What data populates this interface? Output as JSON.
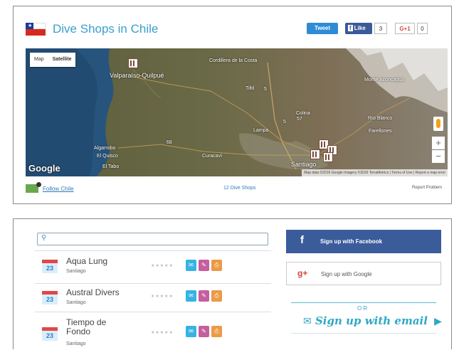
{
  "header": {
    "title": "Dive Shops in Chile",
    "tweet_label": "Tweet",
    "like_label": "Like",
    "like_count": "3",
    "gplus_label": "G+1",
    "gplus_count": "0"
  },
  "map": {
    "types": [
      "Map",
      "Satellite"
    ],
    "selected_type": "Satellite",
    "labels": {
      "valparaiso": "Valparaíso-Quilpué",
      "santiago": "Santiago",
      "algarrobo": "Algarrobo",
      "el_tabo": "El Tabo",
      "pinos": "Pinos",
      "el_quisco": "El Quisco",
      "curacavi": "Curacaví",
      "colina": "Colina",
      "tiltil": "Tiltil",
      "lampa": "Lampa",
      "cordillera": "Cordillera de la Costa",
      "los_andes": "Los Andes",
      "farellones": "Farellones",
      "rio_blanco": "Río Blanco",
      "plantilla": "Plantilla",
      "route_68": "68",
      "route_5": "5",
      "route_57": "57",
      "route_5b": "5",
      "aconcagua": "Monte Aconcagua"
    },
    "google": "Google",
    "attribution": "Map data ©2016 Google Imagery ©2016 TerraMetrics | Terms of Use | Report a map error",
    "zoom_in": "+",
    "zoom_out": "−"
  },
  "footer": {
    "follow": "Follow Chile",
    "shop_count": "12 Dive Shops",
    "report": "Report Problem"
  },
  "shops": [
    {
      "name": "Aqua Lung",
      "city": "Santiago",
      "day": "23"
    },
    {
      "name": "Austral Divers",
      "city": "Santiago",
      "day": "23"
    },
    {
      "name": "Tiempo de Fondo",
      "city": "Santiago",
      "day": "23"
    }
  ],
  "stars": "★★★★★",
  "signup": {
    "facebook": "Sign up with Facebook",
    "google": "Sign up with Google",
    "or": "OR",
    "email": "Sign up with email"
  }
}
